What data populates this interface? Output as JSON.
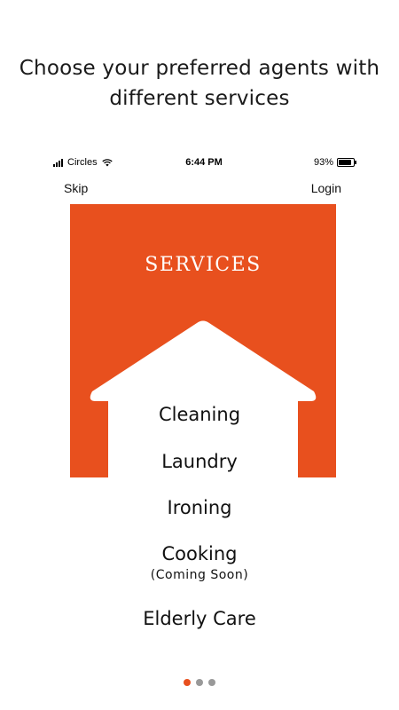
{
  "headline": {
    "line1": "Choose your preferred agents with",
    "line2": "different services"
  },
  "status_bar": {
    "carrier": "Circles",
    "time": "6:44 PM",
    "battery": "93%"
  },
  "nav": {
    "skip_label": "Skip",
    "login_label": "Login"
  },
  "services": {
    "title": "SERVICES",
    "items": [
      {
        "label": "Cleaning"
      },
      {
        "label": "Laundry"
      },
      {
        "label": "Ironing"
      },
      {
        "label": "Cooking",
        "note": "(Coming Soon)"
      },
      {
        "label": "Elderly Care"
      }
    ]
  },
  "pagination": {
    "current": 1,
    "total": 3
  },
  "colors": {
    "accent": "#e8501e",
    "inactive_dot": "#999999",
    "text": "#111111"
  }
}
